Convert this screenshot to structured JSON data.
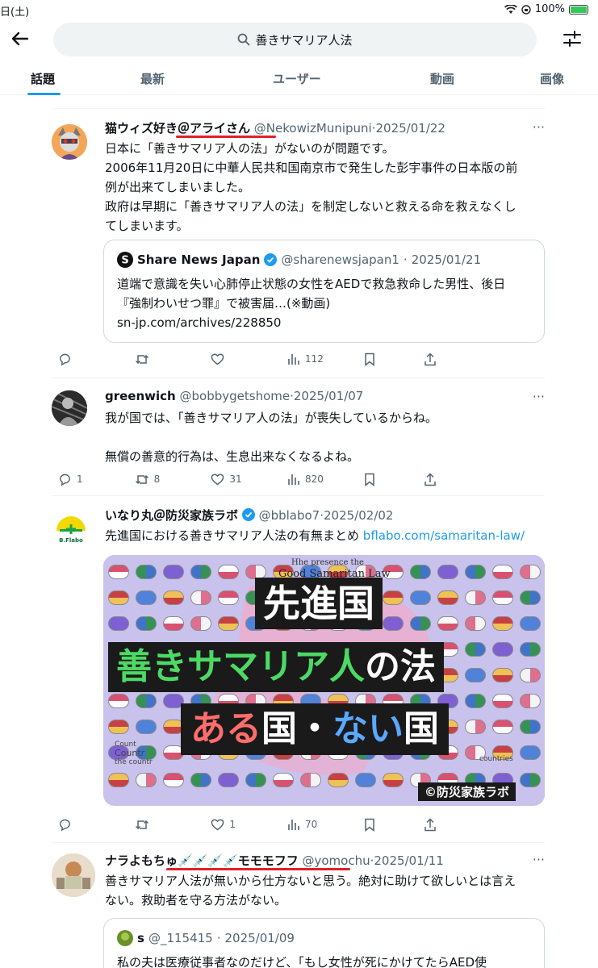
{
  "status": {
    "time": "日(土)",
    "battery": "100%"
  },
  "search": {
    "query": "善きサマリア人法"
  },
  "tabs": [
    "話題",
    "最新",
    "ユーザー",
    "動画",
    "画像"
  ],
  "colors": {
    "accent": "#1d9bf0",
    "annotation_red": "#e0202a",
    "verified": "#1d9bf0"
  },
  "tweets": [
    {
      "name": "猫ウィズ好き＠アライさん",
      "handle": "@NekowizMunipuni",
      "date": "2025/01/22",
      "lines": [
        "日本に「善きサマリア人の法」がないのが問題です。",
        "2006年11月20日に中華人民共和国南京市で発生した彭宇事件の日本版の前",
        "例が出来てしまいました。",
        "政府は早期に「善きサマリア人の法」を制定しないと救える命を救えなくし",
        "てしまいます。"
      ],
      "quote": {
        "name": "Share News Japan",
        "handle": "@sharenewsjapan1",
        "date": "2025/01/21",
        "lines": [
          "道端で意識を失い心肺停止状態の女性をAEDで救急救命した男性、後日",
          "『強制わいせつ罪』で被害届…(※動画)",
          "sn-jp.com/archives/228850"
        ]
      },
      "stats": {
        "replies": "",
        "retweets": "",
        "likes": "",
        "views": "112"
      }
    },
    {
      "name": "greenwich",
      "handle": "@bobbygetshome",
      "date": "2025/01/07",
      "lines": [
        "我が国では、「善きサマリア人の法」が喪失しているからね。",
        "",
        "無償の善意的行為は、生息出来なくなるよね。"
      ],
      "stats": {
        "replies": "1",
        "retweets": "8",
        "likes": "31",
        "views": "820"
      }
    },
    {
      "name": "いなり丸＠防災家族ラボ",
      "handle": "@bblabo7",
      "date": "2025/02/02",
      "text": "先進国における善きサマリア人法の有無まとめ",
      "link": "bflabo.com/samaritan-law/",
      "avatar_text": "B.Flabo",
      "image": {
        "top_caption": "Hhe presence the",
        "top_caption2": "Good Samaritan Law",
        "line1": "先進国",
        "line2a": "善きサマリア人",
        "line2b": "の法",
        "line3a": "ある",
        "line3b": "国・",
        "line3c": "ない",
        "line3d": "国",
        "watermark": "©防災家族ラボ",
        "left_small": "Count",
        "left_small2": "Countr",
        "left_small3": "the countr",
        "right_small": "countries"
      },
      "stats": {
        "replies": "",
        "retweets": "",
        "likes": "1",
        "views": "70"
      }
    },
    {
      "name": "ナラよもちゅ💉💉💉💉モモモフフ",
      "handle": "@yomochu",
      "date": "2025/01/11",
      "lines": [
        "善きサマリア人法が無いから仕方ないと思う。絶対に助けて欲しいとは言え",
        "ない。救助者を守る方法がない。"
      ],
      "quote": {
        "name": "s",
        "handle": "@_115415",
        "date": "2025/01/09",
        "lines": [
          "私の夫は医療従事者なのだけど、「もし女性が死にかけてたらAED使"
        ]
      }
    }
  ]
}
